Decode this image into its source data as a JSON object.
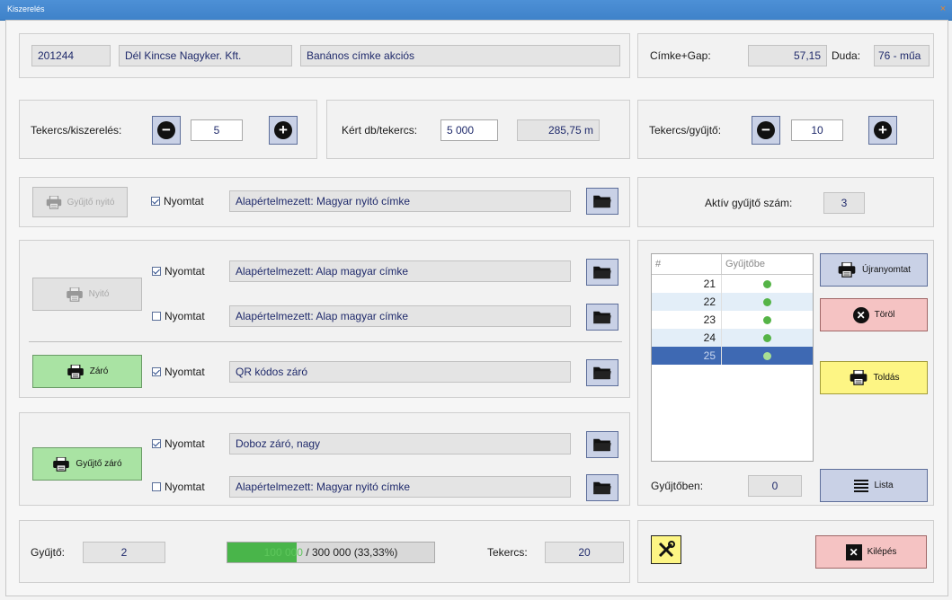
{
  "window": {
    "title": "Kiszerelés",
    "close_glyph": "×"
  },
  "header": {
    "code": "201244",
    "company": "Dél Kincse Nagyker. Kft.",
    "product": "Banános címke akciós",
    "label_gap_label": "Címke+Gap:",
    "label_gap_value": "57,15",
    "duda_label": "Duda:",
    "duda_value": "76 - műa"
  },
  "roll_per_package": {
    "label": "Tekercs/kiszerelés:",
    "value": "5"
  },
  "requested": {
    "label": "Kért db/tekercs:",
    "value": "5 000",
    "length": "285,75 m"
  },
  "roll_per_collector": {
    "label": "Tekercs/gyűjtő:",
    "value": "10"
  },
  "collector_opener": {
    "button_label": "Gyűjtő nyitó",
    "print_label": "Nyomtat",
    "print_checked": true,
    "template": "Alapértelmezett: Magyar nyitó címke"
  },
  "active_collector": {
    "label": "Aktív gyűjtő szám:",
    "value": "3"
  },
  "opener": {
    "button_label": "Nyitó",
    "rows": [
      {
        "print_label": "Nyomtat",
        "checked": true,
        "template": "Alapértelmezett: Alap magyar címke"
      },
      {
        "print_label": "Nyomtat",
        "checked": false,
        "template": "Alapértelmezett: Alap magyar címke"
      }
    ]
  },
  "closer": {
    "button_label": "Záró",
    "print_label": "Nyomtat",
    "print_checked": true,
    "template": "QR kódos záró"
  },
  "collector_closer": {
    "button_label": "Gyűjtő záró",
    "rows": [
      {
        "print_label": "Nyomtat",
        "checked": true,
        "template": "Doboz záró, nagy"
      },
      {
        "print_label": "Nyomtat",
        "checked": false,
        "template": "Alapértelmezett: Magyar nyitó címke"
      }
    ]
  },
  "grid": {
    "columns": [
      "#",
      "Gyűjtőbe"
    ],
    "rows": [
      {
        "num": "21",
        "in_collector": true
      },
      {
        "num": "22",
        "in_collector": true
      },
      {
        "num": "23",
        "in_collector": true
      },
      {
        "num": "24",
        "in_collector": true
      },
      {
        "num": "25",
        "in_collector": true
      }
    ],
    "selected_row": "25"
  },
  "actions": {
    "reprint": "Újranyomtat",
    "delete": "Töröl",
    "append": "Toldás",
    "list": "Lista"
  },
  "in_collector": {
    "label": "Gyűjtőben:",
    "value": "0"
  },
  "footer": {
    "collector_label": "Gyűjtő:",
    "collector_value": "2",
    "progress_done": "100 000",
    "progress_text": "/ 300 000 (33,33%)",
    "progress_fraction": 0.3333,
    "rolls_label": "Tekercs:",
    "rolls_value": "20",
    "exit_label": "Kilépés"
  },
  "colors": {
    "accent_green": "#a9e3a3",
    "accent_blue": "#c9d1e6",
    "accent_pink": "#f5c3c3",
    "accent_yellow": "#fdf584",
    "progress": "#49b54a",
    "selected_row": "#3e69b3"
  }
}
